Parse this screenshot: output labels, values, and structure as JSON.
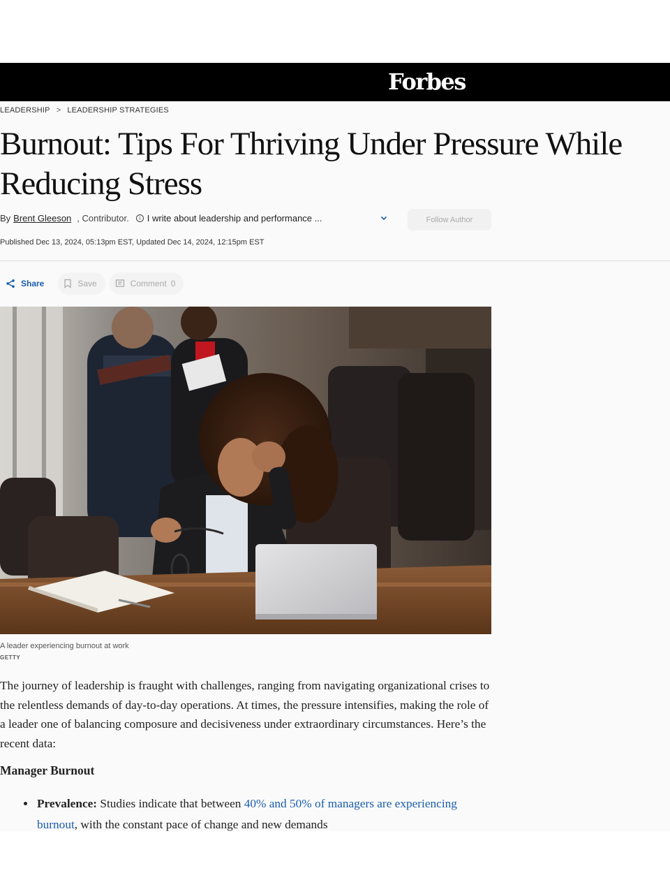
{
  "brand": {
    "logo": "Forbes"
  },
  "breadcrumb": {
    "section": "LEADERSHIP",
    "subsection": "LEADERSHIP STRATEGIES"
  },
  "article": {
    "title": "Burnout: Tips For Thriving Under Pressure While Reducing Stress",
    "byline": {
      "by": "By",
      "author": "Brent Gleeson",
      "role": ", Contributor.",
      "description": "I write about leadership and performance ...",
      "follow_label": "Follow Author"
    },
    "published": "Published Dec 13, 2024, 05:13pm EST, Updated Dec 14, 2024, 12:15pm EST",
    "actions": {
      "share": "Share",
      "save": "Save",
      "comment": "Comment",
      "comment_count": "0"
    },
    "image": {
      "caption": "A leader experiencing burnout at work",
      "credit": "GETTY"
    },
    "paragraph_1": "The journey of leadership is fraught with challenges, ranging from navigating organizational crises to the relentless demands of day-to-day operations. At times, the pressure intensifies, making the role of a leader one of balancing composure and decisiveness under extraordinary circumstances. Here’s the recent data:",
    "subheading": "Manager Burnout",
    "bullet_1": {
      "label": "Prevalence",
      "colon": ":",
      "text_before": " Studies indicate that between ",
      "link": "40% and 50% of managers are experiencing burnout",
      "text_after": ", with the constant pace of change and new demands"
    }
  },
  "colors": {
    "topbar": "#000000",
    "link": "#1a5dab",
    "page_bg": "#fafafa"
  },
  "icons": [
    "share-icon",
    "bookmark-icon",
    "comment-icon",
    "info-icon",
    "chevron-down-icon"
  ]
}
